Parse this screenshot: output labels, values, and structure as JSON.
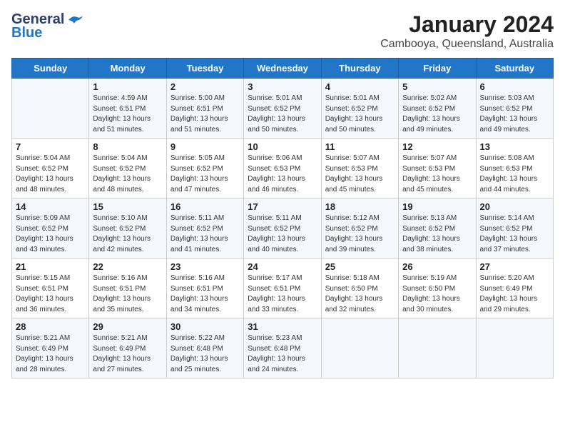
{
  "logo": {
    "line1": "General",
    "line2": "Blue"
  },
  "title": "January 2024",
  "subtitle": "Cambooya, Queensland, Australia",
  "days_of_week": [
    "Sunday",
    "Monday",
    "Tuesday",
    "Wednesday",
    "Thursday",
    "Friday",
    "Saturday"
  ],
  "weeks": [
    [
      {
        "day": "",
        "sunrise": "",
        "sunset": "",
        "daylight": ""
      },
      {
        "day": "1",
        "sunrise": "Sunrise: 4:59 AM",
        "sunset": "Sunset: 6:51 PM",
        "daylight": "Daylight: 13 hours and 51 minutes."
      },
      {
        "day": "2",
        "sunrise": "Sunrise: 5:00 AM",
        "sunset": "Sunset: 6:51 PM",
        "daylight": "Daylight: 13 hours and 51 minutes."
      },
      {
        "day": "3",
        "sunrise": "Sunrise: 5:01 AM",
        "sunset": "Sunset: 6:52 PM",
        "daylight": "Daylight: 13 hours and 50 minutes."
      },
      {
        "day": "4",
        "sunrise": "Sunrise: 5:01 AM",
        "sunset": "Sunset: 6:52 PM",
        "daylight": "Daylight: 13 hours and 50 minutes."
      },
      {
        "day": "5",
        "sunrise": "Sunrise: 5:02 AM",
        "sunset": "Sunset: 6:52 PM",
        "daylight": "Daylight: 13 hours and 49 minutes."
      },
      {
        "day": "6",
        "sunrise": "Sunrise: 5:03 AM",
        "sunset": "Sunset: 6:52 PM",
        "daylight": "Daylight: 13 hours and 49 minutes."
      }
    ],
    [
      {
        "day": "7",
        "sunrise": "Sunrise: 5:04 AM",
        "sunset": "Sunset: 6:52 PM",
        "daylight": "Daylight: 13 hours and 48 minutes."
      },
      {
        "day": "8",
        "sunrise": "Sunrise: 5:04 AM",
        "sunset": "Sunset: 6:52 PM",
        "daylight": "Daylight: 13 hours and 48 minutes."
      },
      {
        "day": "9",
        "sunrise": "Sunrise: 5:05 AM",
        "sunset": "Sunset: 6:52 PM",
        "daylight": "Daylight: 13 hours and 47 minutes."
      },
      {
        "day": "10",
        "sunrise": "Sunrise: 5:06 AM",
        "sunset": "Sunset: 6:53 PM",
        "daylight": "Daylight: 13 hours and 46 minutes."
      },
      {
        "day": "11",
        "sunrise": "Sunrise: 5:07 AM",
        "sunset": "Sunset: 6:53 PM",
        "daylight": "Daylight: 13 hours and 45 minutes."
      },
      {
        "day": "12",
        "sunrise": "Sunrise: 5:07 AM",
        "sunset": "Sunset: 6:53 PM",
        "daylight": "Daylight: 13 hours and 45 minutes."
      },
      {
        "day": "13",
        "sunrise": "Sunrise: 5:08 AM",
        "sunset": "Sunset: 6:53 PM",
        "daylight": "Daylight: 13 hours and 44 minutes."
      }
    ],
    [
      {
        "day": "14",
        "sunrise": "Sunrise: 5:09 AM",
        "sunset": "Sunset: 6:52 PM",
        "daylight": "Daylight: 13 hours and 43 minutes."
      },
      {
        "day": "15",
        "sunrise": "Sunrise: 5:10 AM",
        "sunset": "Sunset: 6:52 PM",
        "daylight": "Daylight: 13 hours and 42 minutes."
      },
      {
        "day": "16",
        "sunrise": "Sunrise: 5:11 AM",
        "sunset": "Sunset: 6:52 PM",
        "daylight": "Daylight: 13 hours and 41 minutes."
      },
      {
        "day": "17",
        "sunrise": "Sunrise: 5:11 AM",
        "sunset": "Sunset: 6:52 PM",
        "daylight": "Daylight: 13 hours and 40 minutes."
      },
      {
        "day": "18",
        "sunrise": "Sunrise: 5:12 AM",
        "sunset": "Sunset: 6:52 PM",
        "daylight": "Daylight: 13 hours and 39 minutes."
      },
      {
        "day": "19",
        "sunrise": "Sunrise: 5:13 AM",
        "sunset": "Sunset: 6:52 PM",
        "daylight": "Daylight: 13 hours and 38 minutes."
      },
      {
        "day": "20",
        "sunrise": "Sunrise: 5:14 AM",
        "sunset": "Sunset: 6:52 PM",
        "daylight": "Daylight: 13 hours and 37 minutes."
      }
    ],
    [
      {
        "day": "21",
        "sunrise": "Sunrise: 5:15 AM",
        "sunset": "Sunset: 6:51 PM",
        "daylight": "Daylight: 13 hours and 36 minutes."
      },
      {
        "day": "22",
        "sunrise": "Sunrise: 5:16 AM",
        "sunset": "Sunset: 6:51 PM",
        "daylight": "Daylight: 13 hours and 35 minutes."
      },
      {
        "day": "23",
        "sunrise": "Sunrise: 5:16 AM",
        "sunset": "Sunset: 6:51 PM",
        "daylight": "Daylight: 13 hours and 34 minutes."
      },
      {
        "day": "24",
        "sunrise": "Sunrise: 5:17 AM",
        "sunset": "Sunset: 6:51 PM",
        "daylight": "Daylight: 13 hours and 33 minutes."
      },
      {
        "day": "25",
        "sunrise": "Sunrise: 5:18 AM",
        "sunset": "Sunset: 6:50 PM",
        "daylight": "Daylight: 13 hours and 32 minutes."
      },
      {
        "day": "26",
        "sunrise": "Sunrise: 5:19 AM",
        "sunset": "Sunset: 6:50 PM",
        "daylight": "Daylight: 13 hours and 30 minutes."
      },
      {
        "day": "27",
        "sunrise": "Sunrise: 5:20 AM",
        "sunset": "Sunset: 6:49 PM",
        "daylight": "Daylight: 13 hours and 29 minutes."
      }
    ],
    [
      {
        "day": "28",
        "sunrise": "Sunrise: 5:21 AM",
        "sunset": "Sunset: 6:49 PM",
        "daylight": "Daylight: 13 hours and 28 minutes."
      },
      {
        "day": "29",
        "sunrise": "Sunrise: 5:21 AM",
        "sunset": "Sunset: 6:49 PM",
        "daylight": "Daylight: 13 hours and 27 minutes."
      },
      {
        "day": "30",
        "sunrise": "Sunrise: 5:22 AM",
        "sunset": "Sunset: 6:48 PM",
        "daylight": "Daylight: 13 hours and 25 minutes."
      },
      {
        "day": "31",
        "sunrise": "Sunrise: 5:23 AM",
        "sunset": "Sunset: 6:48 PM",
        "daylight": "Daylight: 13 hours and 24 minutes."
      },
      {
        "day": "",
        "sunrise": "",
        "sunset": "",
        "daylight": ""
      },
      {
        "day": "",
        "sunrise": "",
        "sunset": "",
        "daylight": ""
      },
      {
        "day": "",
        "sunrise": "",
        "sunset": "",
        "daylight": ""
      }
    ]
  ]
}
